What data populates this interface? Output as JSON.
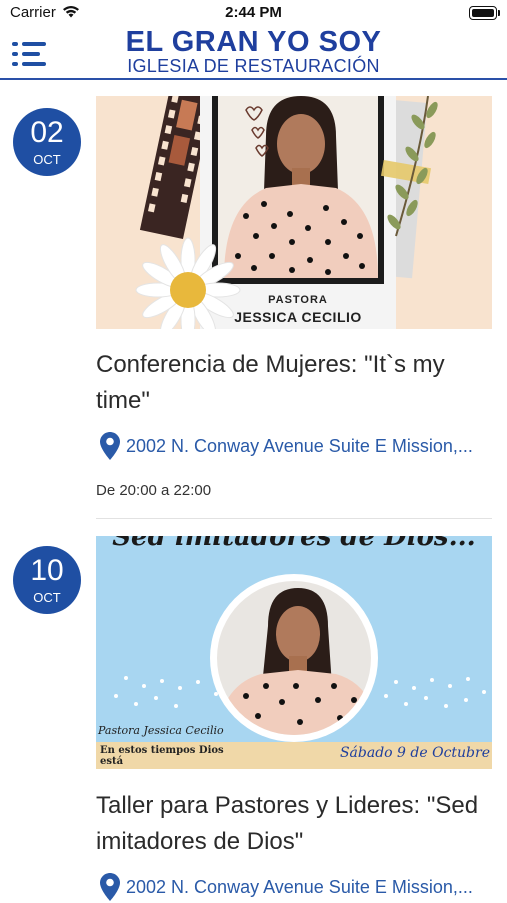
{
  "status_bar": {
    "carrier": "Carrier",
    "time": "2:44 PM"
  },
  "header": {
    "title": "EL GRAN YO SOY",
    "subtitle": "IGLESIA DE RESTAURACIÓN",
    "brand_color": "#1f3f9e"
  },
  "events": [
    {
      "day": "02",
      "month": "OCT",
      "title": "Conferencia de Mujeres: \"It`s my time\"",
      "location": "2002 N. Conway Avenue Suite E Mission,...",
      "time": "De 20:00 a 22:00",
      "image": {
        "label_top": "PASTORA",
        "label_name": "JESSICA CECILIO"
      }
    },
    {
      "day": "10",
      "month": "OCT",
      "title": "Taller para Pastores y Lideres: \"Sed imitadores de Dios\"",
      "location": "2002 N. Conway Avenue Suite E Mission,...",
      "image": {
        "header_script": "Sed imitadores de Dios...",
        "name_script": "Pastora Jessica Cecilio",
        "caption": "En estos tiempos Dios está",
        "date_script": "Sábado 9 de Octubre"
      }
    }
  ],
  "colors": {
    "accent": "#1f4fa3",
    "link": "#2a5aa8"
  }
}
